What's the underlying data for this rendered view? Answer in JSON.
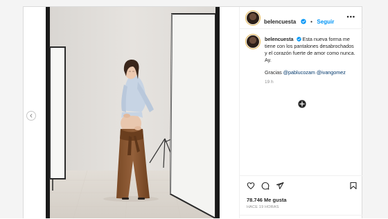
{
  "post": {
    "header": {
      "username": "belencuesta",
      "separator": "•",
      "follow_label": "Seguir",
      "more_label": "•••"
    },
    "caption": {
      "username": "belencuesta",
      "text": "Esta nueva forma me tiene con los pantalones desabrochados y el corazón fuerte de amor como nunca. Ay.",
      "thanks_prefix": "Gracias ",
      "mention_1": "@pablucozam",
      "mention_2": "@ivangomez",
      "time": "19 h"
    },
    "likes": "78.746 Me gusta",
    "posted_ago": "HACE 19 HORAS"
  },
  "colors": {
    "accent": "#0095f6",
    "mention": "#00376b",
    "verified": "#0095f6"
  },
  "icons": {
    "prev": "chevron-left-icon",
    "verified": "verified-badge-icon",
    "add_comment": "add-circle-icon",
    "like": "heart-icon",
    "comment": "comment-icon",
    "share": "paper-plane-icon",
    "save": "bookmark-icon"
  }
}
